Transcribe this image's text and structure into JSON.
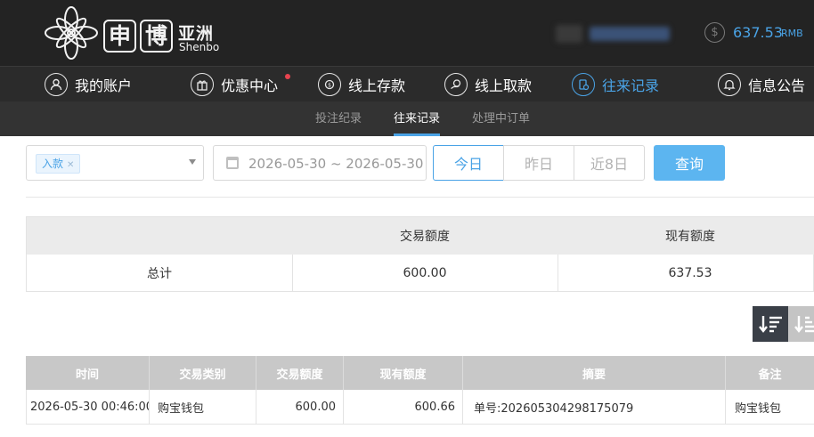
{
  "header": {
    "logo_char_1": "申",
    "logo_char_2": "博",
    "logo_cn": "亚洲",
    "logo_en": "Shenbo",
    "balance_amount": "637.53",
    "balance_unit": "RMB",
    "balance_icon": "dollar-icon"
  },
  "nav": {
    "items": [
      {
        "label": "我的账户",
        "icon": "user-icon"
      },
      {
        "label": "优惠中心",
        "icon": "gift-icon"
      },
      {
        "label": "线上存款",
        "icon": "deposit-icon"
      },
      {
        "label": "线上取款",
        "icon": "withdraw-icon"
      },
      {
        "label": "往来记录",
        "icon": "records-icon"
      },
      {
        "label": "信息公告",
        "icon": "bell-icon"
      }
    ],
    "active_index": 4,
    "accent": "#4aa3e6"
  },
  "subnav": {
    "items": [
      {
        "label": "投注纪录"
      },
      {
        "label": "往来记录"
      },
      {
        "label": "处理中订单"
      }
    ],
    "active_index": 1
  },
  "filters": {
    "type_tag": "入款",
    "date_range": "2026-05-30 ~ 2026-05-30",
    "segments": [
      {
        "label": "今日"
      },
      {
        "label": "昨日"
      },
      {
        "label": "近8日"
      }
    ],
    "active_segment": 0,
    "query_label": "查询"
  },
  "summary": {
    "headers": [
      "",
      "交易额度",
      "现有额度"
    ],
    "row": {
      "label": "总计",
      "trade_amount": "600.00",
      "current_amount": "637.53"
    }
  },
  "table": {
    "headers": [
      "时间",
      "交易类别",
      "交易额度",
      "现有额度",
      "摘要",
      "备注"
    ],
    "rows": [
      {
        "time": "2026-05-30 00:46:00",
        "category": "购宝钱包",
        "amount": "600.00",
        "balance": "600.66",
        "summary": "单号:202605304298175079",
        "note": "购宝钱包"
      }
    ]
  }
}
